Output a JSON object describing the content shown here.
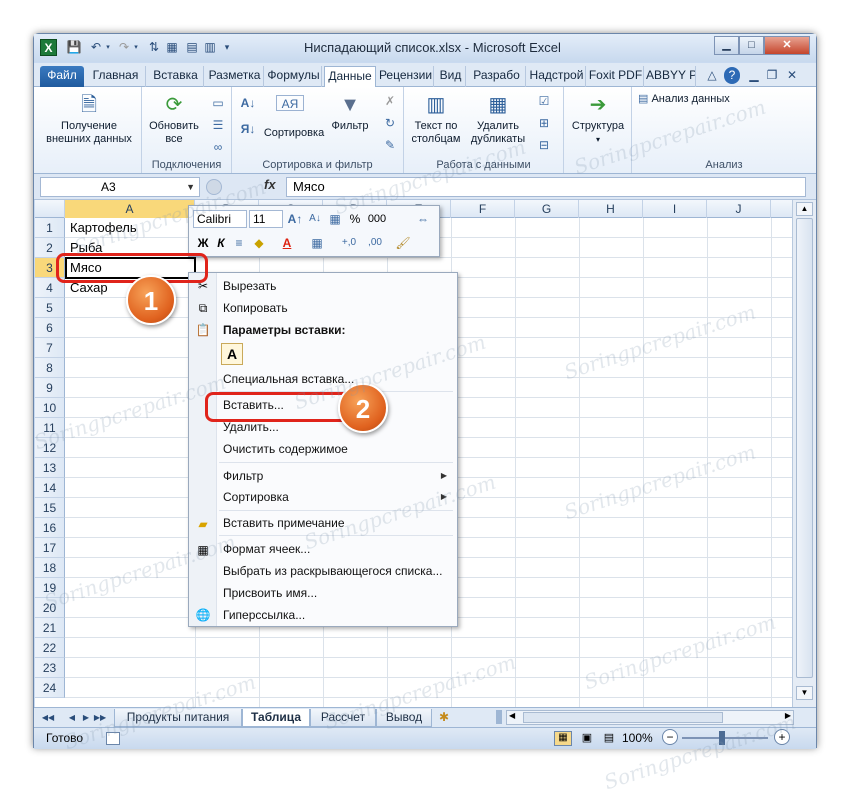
{
  "window": {
    "title": "Ниспадающий список.xlsx - Microsoft Excel",
    "logo_letter": "X",
    "min_icon": "minimize-icon",
    "max_icon": "maximize-icon",
    "close_icon": "close-icon"
  },
  "tabs": [
    "Файл",
    "Главная",
    "Вставка",
    "Разметка",
    "Формулы",
    "Данные",
    "Рецензии",
    "Вид",
    "Разрабо",
    "Надстрой",
    "Foxit PDF",
    "ABBYY PD"
  ],
  "active_tab": "Данные",
  "ribbon": {
    "get_external": "Получение внешних данных",
    "refresh_all": "Обновить все",
    "sort": "Сортировка",
    "filter": "Фильтр",
    "text_to_columns": "Текст по столбцам",
    "remove_duplicates": "Удалить дубликаты",
    "structure": "Структура",
    "data_analysis": "Анализ данных",
    "group_connections": "Подключения",
    "group_sort_filter": "Сортировка и фильтр",
    "group_data_tools": "Работа с данными",
    "group_analysis": "Анализ"
  },
  "formula_bar": {
    "name_box": "A3",
    "fx": "fx",
    "formula": "Мясо"
  },
  "columns": [
    "A",
    "B",
    "C",
    "D",
    "E",
    "F",
    "G",
    "H",
    "I",
    "J"
  ],
  "rows": [
    "1",
    "2",
    "3",
    "4",
    "5",
    "6",
    "7",
    "8",
    "9",
    "10",
    "11",
    "12",
    "13",
    "14",
    "15",
    "16",
    "17",
    "18",
    "19",
    "20",
    "21",
    "22",
    "23",
    "24"
  ],
  "cells": {
    "A1": "Картофель",
    "A2": "Рыба",
    "A3": "Мясо",
    "A4": "Сахар"
  },
  "mini_toolbar": {
    "font": "Calibri",
    "size": "11",
    "percent": "%",
    "thousands": "000",
    "bold": "Ж",
    "italic": "К",
    "font_color_letter": "A"
  },
  "context_menu": {
    "cut": "Вырезать",
    "copy": "Копировать",
    "paste_options": "Параметры вставки:",
    "paste_letter": "A",
    "paste_special": "Специальная вставка...",
    "insert": "Вставить...",
    "delete": "Удалить...",
    "clear": "Очистить содержимое",
    "filter": "Фильтр",
    "sort": "Сортировка",
    "insert_comment": "Вставить примечание",
    "format_cells": "Формат ячеек...",
    "pick_from_list": "Выбрать из раскрывающегося списка...",
    "define_name": "Присвоить имя...",
    "hyperlink": "Гиперссылка..."
  },
  "sheet_tabs": [
    "Продукты питания",
    "Таблица",
    "Рассчет",
    "Вывод"
  ],
  "active_sheet": "Таблица",
  "status": {
    "ready": "Готово",
    "zoom": "100%",
    "zoom_minus": "−",
    "zoom_plus": "+"
  },
  "callouts": [
    "1",
    "2"
  ],
  "watermark": "Soringpcrepair.com"
}
